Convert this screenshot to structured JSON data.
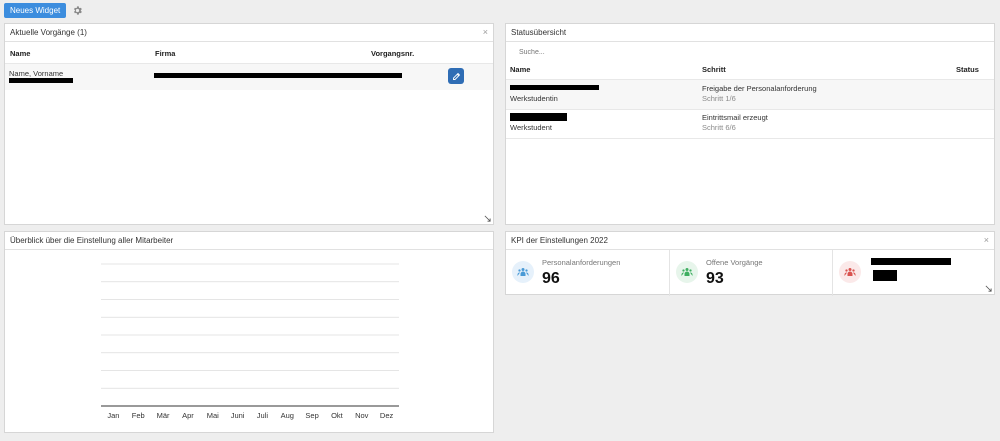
{
  "toolbar": {
    "new_widget_label": "Neues Widget",
    "settings_icon": "gear-icon"
  },
  "current": {
    "title": "Aktuelle Vorgänge (1)",
    "columns": [
      "Name",
      "Firma",
      "Vorgangsnr."
    ],
    "row": {
      "name": "Name, Vorname"
    }
  },
  "status": {
    "title": "Statusübersicht",
    "search_placeholder": "Suche...",
    "columns": [
      "Name",
      "Schritt",
      "Status"
    ],
    "rows": [
      {
        "role": "Werkstudentin",
        "step": "Freigabe der Personalanforderung",
        "step_no": "Schritt 1/6"
      },
      {
        "role": "Werkstudent",
        "step": "Eintrittsmail erzeugt",
        "step_no": "Schritt 6/6"
      }
    ]
  },
  "overview": {
    "title": "Überblick über die Einstellung aller Mitarbeiter"
  },
  "chart_data": {
    "type": "line",
    "categories": [
      "Jan",
      "Feb",
      "Mär",
      "Apr",
      "Mai",
      "Juni",
      "Juli",
      "Aug",
      "Sep",
      "Okt",
      "Nov",
      "Dez"
    ],
    "series": [],
    "grid": true,
    "legend": "none"
  },
  "kpi": {
    "title": "KPI der Einstellungen 2022",
    "cards": [
      {
        "label": "Personalanforderungen",
        "value": "96",
        "color": "#4a9ad6",
        "bg": "#e6f1fb"
      },
      {
        "label": "Offene Vorgänge",
        "value": "93",
        "color": "#3fae61",
        "bg": "#e7f5eb"
      },
      {
        "label": "",
        "value": "",
        "color": "#d9534f",
        "bg": "#fbe9e9"
      }
    ]
  }
}
